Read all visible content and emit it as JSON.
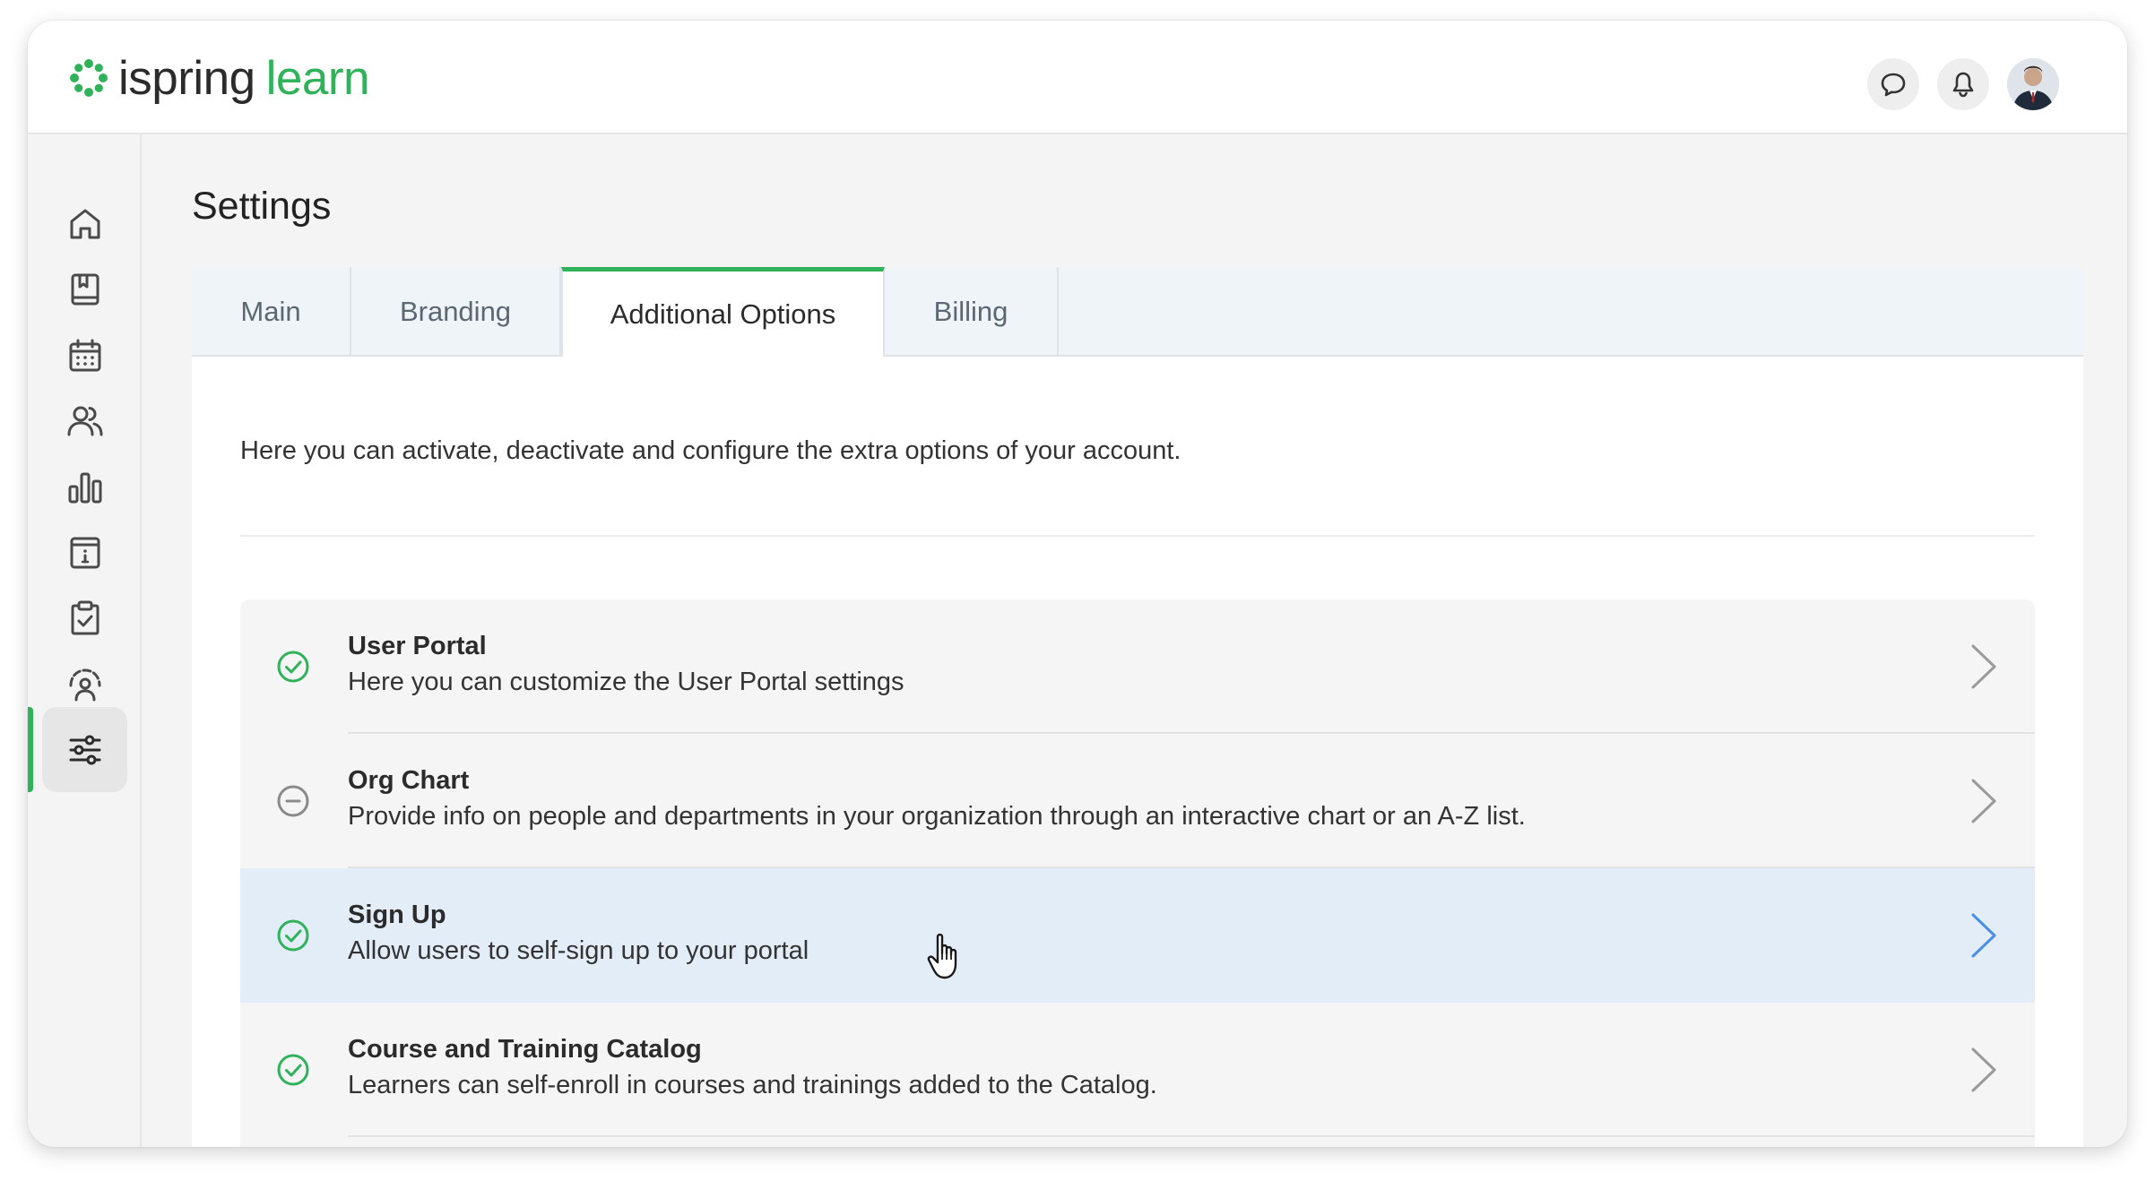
{
  "app": {
    "brand": "ispring",
    "product": "learn"
  },
  "colors": {
    "accent": "#2fb25a",
    "highlight_row": "#e3edf8",
    "chevron_active": "#4a8fe0",
    "chevron_default": "#9a9a9a"
  },
  "header": {
    "icons": [
      "chat-bubble-icon",
      "bell-icon"
    ],
    "avatar": "user-avatar"
  },
  "sidebar": {
    "items": [
      {
        "icon": "home-icon",
        "active": false
      },
      {
        "icon": "book-icon",
        "active": false
      },
      {
        "icon": "calendar-icon",
        "active": false
      },
      {
        "icon": "users-icon",
        "active": false
      },
      {
        "icon": "bar-chart-icon",
        "active": false
      },
      {
        "icon": "info-calendar-icon",
        "active": false
      },
      {
        "icon": "clipboard-check-icon",
        "active": false
      },
      {
        "icon": "person-gauge-icon",
        "active": false
      },
      {
        "icon": "sliders-icon",
        "active": true
      }
    ]
  },
  "main": {
    "title": "Settings",
    "tabs": [
      {
        "label": "Main",
        "active": false
      },
      {
        "label": "Branding",
        "active": false
      },
      {
        "label": "Additional Options",
        "active": true
      },
      {
        "label": "Billing",
        "active": false
      }
    ],
    "intro": "Here you can activate, deactivate and configure the extra options of your account.",
    "options": [
      {
        "title": "User Portal",
        "description": "Here you can customize the User Portal settings",
        "status": "enabled"
      },
      {
        "title": "Org Chart",
        "description": "Provide info on people and departments in your organization through an interactive chart or an A-Z list.",
        "status": "disabled"
      },
      {
        "title": "Sign Up",
        "description": "Allow users to self-sign up to your portal",
        "status": "enabled",
        "hovered": true
      },
      {
        "title": "Course and Training Catalog",
        "description": "Learners can self-enroll in courses and trainings added to the Catalog.",
        "status": "enabled"
      }
    ]
  }
}
